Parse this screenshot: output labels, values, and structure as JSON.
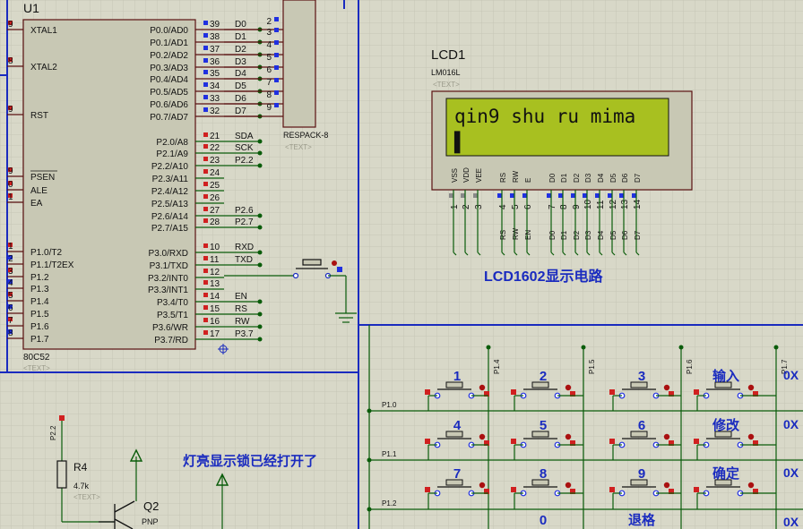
{
  "colors": {
    "background": "#d8d8c8",
    "grid": "#c6c6b6",
    "wire": "#0a5c0a",
    "bus": "#1a2bbf",
    "component_body": "#c8c8b4",
    "lcd_screen": "#a8c020",
    "text_blue": "#1a2bbf",
    "pin_red": "#d02020",
    "pin_blue": "#2030e0"
  },
  "mcu": {
    "ref": "U1",
    "part": "80C52",
    "text_tag": "<TEXT>",
    "left_pins": [
      {
        "num": "19",
        "name": "XTAL1"
      },
      {
        "num": "18",
        "name": "XTAL2"
      },
      {
        "num": "9",
        "name": "RST"
      },
      {
        "num": "29",
        "name": "PSEN"
      },
      {
        "num": "30",
        "name": "ALE"
      },
      {
        "num": "31",
        "name": "EA"
      },
      {
        "num": "1",
        "name": "P1.0/T2"
      },
      {
        "num": "2",
        "name": "P1.1/T2EX"
      },
      {
        "num": "3",
        "name": "P1.2"
      },
      {
        "num": "4",
        "name": "P1.3"
      },
      {
        "num": "5",
        "name": "P1.4"
      },
      {
        "num": "6",
        "name": "P1.5"
      },
      {
        "num": "7",
        "name": "P1.6"
      },
      {
        "num": "8",
        "name": "P1.7"
      }
    ],
    "right_pins": [
      {
        "num": "39",
        "name": "P0.0/AD0",
        "net": "D0"
      },
      {
        "num": "38",
        "name": "P0.1/AD1",
        "net": "D1"
      },
      {
        "num": "37",
        "name": "P0.2/AD2",
        "net": "D2"
      },
      {
        "num": "36",
        "name": "P0.3/AD3",
        "net": "D3"
      },
      {
        "num": "35",
        "name": "P0.4/AD4",
        "net": "D4"
      },
      {
        "num": "34",
        "name": "P0.5/AD5",
        "net": "D5"
      },
      {
        "num": "33",
        "name": "P0.6/AD6",
        "net": "D6"
      },
      {
        "num": "32",
        "name": "P0.7/AD7",
        "net": "D7"
      },
      {
        "num": "21",
        "name": "P2.0/A8",
        "net": "SDA"
      },
      {
        "num": "22",
        "name": "P2.1/A9",
        "net": "SCK"
      },
      {
        "num": "23",
        "name": "P2.2/A10",
        "net": "P2.2"
      },
      {
        "num": "24",
        "name": "P2.3/A11",
        "net": ""
      },
      {
        "num": "25",
        "name": "P2.4/A12",
        "net": ""
      },
      {
        "num": "26",
        "name": "P2.5/A13",
        "net": ""
      },
      {
        "num": "27",
        "name": "P2.6/A14",
        "net": "P2.6"
      },
      {
        "num": "28",
        "name": "P2.7/A15",
        "net": "P2.7"
      },
      {
        "num": "10",
        "name": "P3.0/RXD",
        "net": "RXD"
      },
      {
        "num": "11",
        "name": "P3.1/TXD",
        "net": "TXD"
      },
      {
        "num": "12",
        "name": "P3.2/INT0",
        "net": ""
      },
      {
        "num": "13",
        "name": "P3.3/INT1",
        "net": ""
      },
      {
        "num": "14",
        "name": "P3.4/T0",
        "net": "EN"
      },
      {
        "num": "15",
        "name": "P3.5/T1",
        "net": "RS"
      },
      {
        "num": "16",
        "name": "P3.6/WR",
        "net": "RW"
      },
      {
        "num": "17",
        "name": "P3.7/RD",
        "net": "P3.7"
      }
    ]
  },
  "respack": {
    "label": "RESPACK-8",
    "text_tag": "<TEXT>",
    "pins": [
      "2",
      "3",
      "4",
      "5",
      "6",
      "7",
      "8",
      "9"
    ]
  },
  "lcd": {
    "ref": "LCD1",
    "part": "LM016L",
    "text_tag": "<TEXT>",
    "line1": "qin9 shu ru mima",
    "line2": "▌",
    "pin_names": [
      "VSS",
      "VDD",
      "VEE",
      "RS",
      "RW",
      "E",
      "D0",
      "D1",
      "D2",
      "D3",
      "D4",
      "D5",
      "D6",
      "D7"
    ],
    "pin_numbers": [
      "1",
      "2",
      "3",
      "4",
      "5",
      "6",
      "7",
      "8",
      "9",
      "10",
      "11",
      "12",
      "13",
      "14"
    ],
    "net_labels": [
      "RS",
      "RW",
      "EN",
      "D0",
      "D1",
      "D2",
      "D3",
      "D4",
      "D5",
      "D6",
      "D7"
    ],
    "caption": "LCD1602显示电路"
  },
  "keypad": {
    "row_labels": [
      "P1.0",
      "P1.1",
      "P1.2"
    ],
    "col_labels": [
      "P1.4",
      "P1.5",
      "P1.6",
      "P1.7"
    ],
    "keys": [
      [
        "1",
        "2",
        "3",
        "输入"
      ],
      [
        "4",
        "5",
        "6",
        "修改"
      ],
      [
        "7",
        "8",
        "9",
        "确定"
      ],
      [
        "",
        "0",
        "退格",
        ""
      ]
    ],
    "edge_labels": [
      "0X",
      "0X",
      "0X",
      "0X"
    ]
  },
  "lower_left": {
    "resistor_ref": "R4",
    "resistor_value": "4.7k",
    "resistor_tag": "<TEXT>",
    "net_label": "P2.2",
    "transistor_ref": "Q2",
    "transistor_type": "PNP",
    "note": "灯亮显示锁已经打开了"
  },
  "misc_left_numbers": [
    "9",
    "8",
    "9",
    "9",
    "0",
    "1",
    "1",
    "2",
    "3",
    "4",
    "5",
    "6",
    "7",
    "8"
  ]
}
